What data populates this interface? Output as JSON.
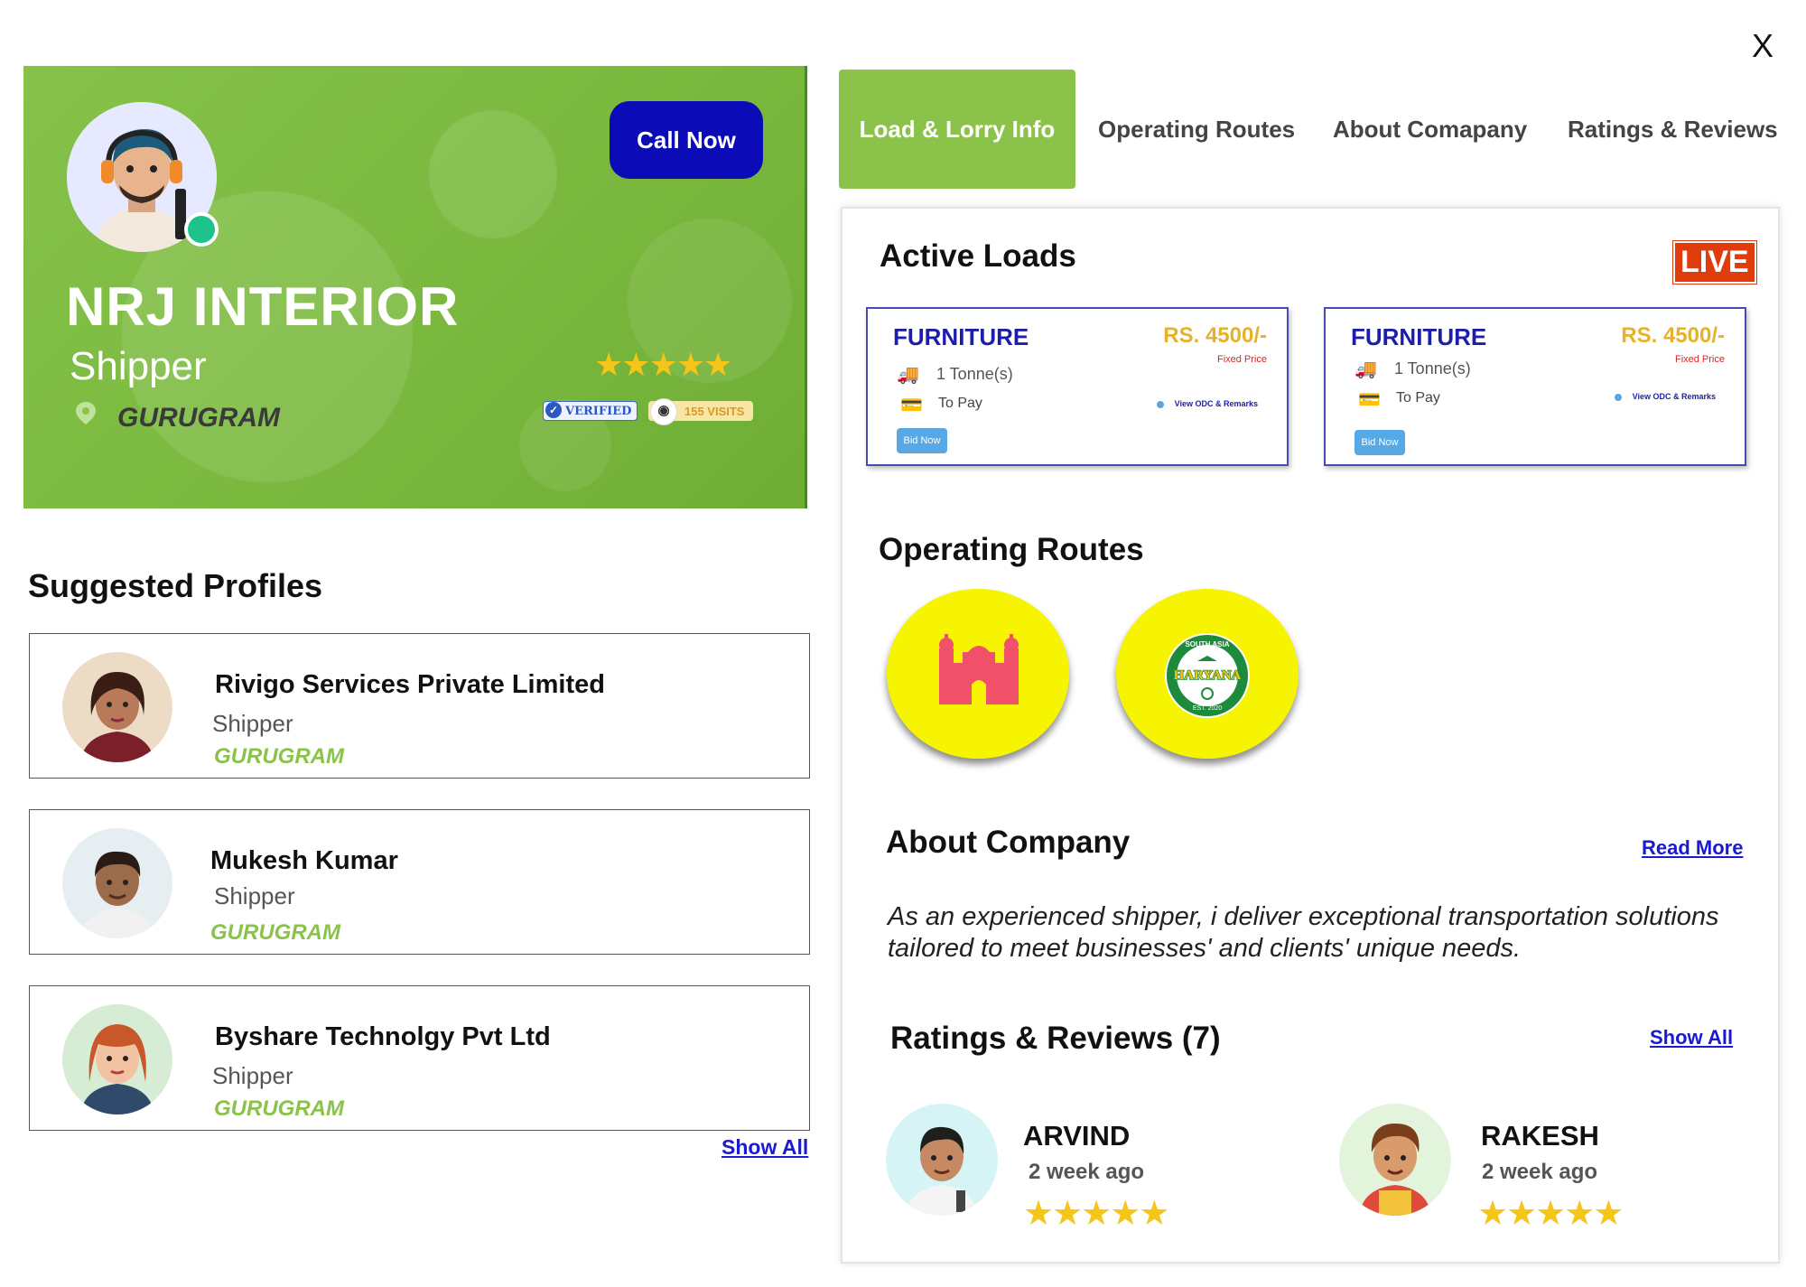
{
  "close_label": "X",
  "profile": {
    "name": "NRJ INTERIOR",
    "role": "Shipper",
    "city": "GURUGRAM",
    "call_label": "Call Now",
    "rating_stars": 5,
    "verified_label": "VERIFIED",
    "visits_label": "155 VISITS"
  },
  "suggested": {
    "title": "Suggested Profiles",
    "show_all": "Show All",
    "items": [
      {
        "name": "Rivigo Services Private Limited",
        "role": "Shipper",
        "city": "GURUGRAM"
      },
      {
        "name": "Mukesh Kumar",
        "role": "Shipper",
        "city": "GURUGRAM"
      },
      {
        "name": "Byshare Technolgy Pvt Ltd",
        "role": "Shipper",
        "city": "GURUGRAM"
      }
    ]
  },
  "tabs": [
    {
      "label": "Load & Lorry Info",
      "active": true
    },
    {
      "label": "Operating Routes",
      "active": false
    },
    {
      "label": "About Comapany",
      "active": false
    },
    {
      "label": "Ratings & Reviews",
      "active": false
    }
  ],
  "active_loads": {
    "title": "Active Loads",
    "live_label": "LIVE",
    "items": [
      {
        "type": "FURNITURE",
        "price": "RS. 4500/-",
        "price_note": "Fixed Price",
        "weight": "1 Tonne(s)",
        "payment": "To Pay",
        "odc_label": "View ODC & Remarks",
        "bid_label": "Bid Now"
      },
      {
        "type": "FURNITURE",
        "price": "RS. 4500/-",
        "price_note": "Fixed Price",
        "weight": "1 Tonne(s)",
        "payment": "To Pay",
        "odc_label": "View ODC & Remarks",
        "bid_label": "Bid Now"
      }
    ]
  },
  "routes": {
    "title": "Operating Routes",
    "badge_text_top": "SOUTH ASIA",
    "badge_text_main": "HARYANA",
    "badge_text_bottom": "EST. 2020"
  },
  "about": {
    "title": "About Company",
    "read_more": "Read More",
    "text": "As an experienced shipper, i deliver exceptional transportation solutions tailored to meet businesses' and clients' unique needs."
  },
  "reviews": {
    "title": "Ratings & Reviews (7)",
    "show_all": "Show All",
    "items": [
      {
        "name": "ARVIND",
        "time": "2 week ago",
        "stars": 5
      },
      {
        "name": "RAKESH",
        "time": "2 week ago",
        "stars": 5
      }
    ]
  },
  "colors": {
    "brand_green": "#8bc34a",
    "call_blue": "#0b0bb8",
    "link_blue": "#1a1ad0",
    "live_red": "#e03c0e",
    "star_gold": "#f5c518",
    "route_yellow": "#f7f401"
  }
}
